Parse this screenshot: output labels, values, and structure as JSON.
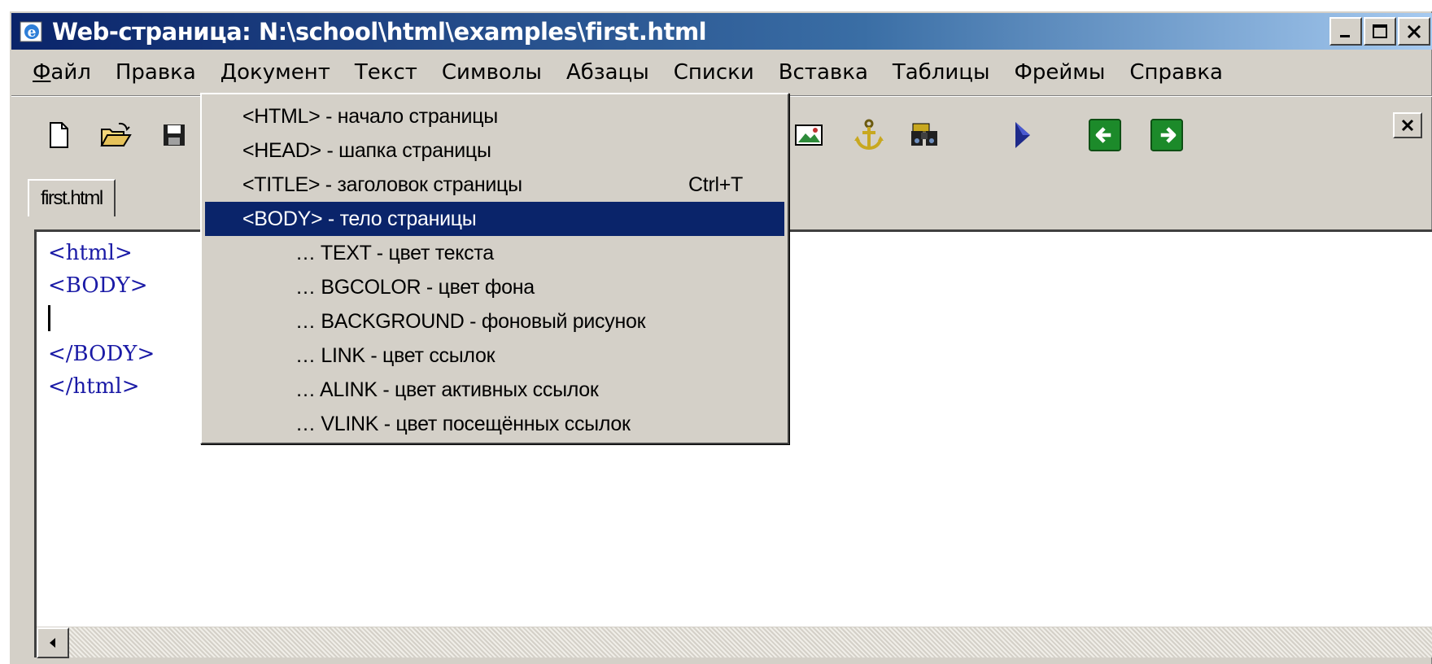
{
  "window": {
    "title": "Web-страница: N:\\school\\html\\examples\\first.html",
    "minimize": "_",
    "maximize": "□",
    "close": "X"
  },
  "menubar": {
    "items": [
      "Файл",
      "Правка",
      "Документ",
      "Текст",
      "Символы",
      "Абзацы",
      "Списки",
      "Вставка",
      "Таблицы",
      "Фреймы",
      "Справка"
    ]
  },
  "toolbar": {
    "icons": [
      "new-file-icon",
      "open-folder-icon",
      "save-icon",
      "image-icon",
      "anchor-icon",
      "find-icon",
      "play-icon",
      "back-arrow-icon",
      "forward-arrow-icon"
    ],
    "close": "X"
  },
  "tabs": [
    {
      "label": "first.html",
      "active": true
    }
  ],
  "editor": {
    "lines": [
      "<html>",
      "<BODY>",
      "",
      "</BODY>",
      "</html>"
    ],
    "code_color": "#1a1aa6"
  },
  "dropdown": {
    "items": [
      {
        "label": "<HTML> - начало страницы",
        "shortcut": ""
      },
      {
        "label": "<HEAD> - шапка страницы",
        "shortcut": ""
      },
      {
        "label": "<TITLE> - заголовок страницы",
        "shortcut": "Ctrl+T"
      },
      {
        "label": "<BODY> - тело страницы",
        "shortcut": "",
        "selected": true
      },
      {
        "label": "… TEXT - цвет текста",
        "shortcut": "",
        "sub": true
      },
      {
        "label": "… BGCOLOR - цвет фона",
        "shortcut": "",
        "sub": true
      },
      {
        "label": "… BACKGROUND - фоновый рисунок",
        "shortcut": "",
        "sub": true
      },
      {
        "label": "… LINK - цвет ссылок",
        "shortcut": "",
        "sub": true
      },
      {
        "label": "… ALINK - цвет активных ссылок",
        "shortcut": "",
        "sub": true
      },
      {
        "label": "… VLINK - цвет посещённых ссылок",
        "shortcut": "",
        "sub": true
      }
    ]
  },
  "colors": {
    "titlebar_start": "#0a246a",
    "titlebar_end": "#a6caf0",
    "selection": "#0a246a",
    "face": "#d4d0c8"
  }
}
